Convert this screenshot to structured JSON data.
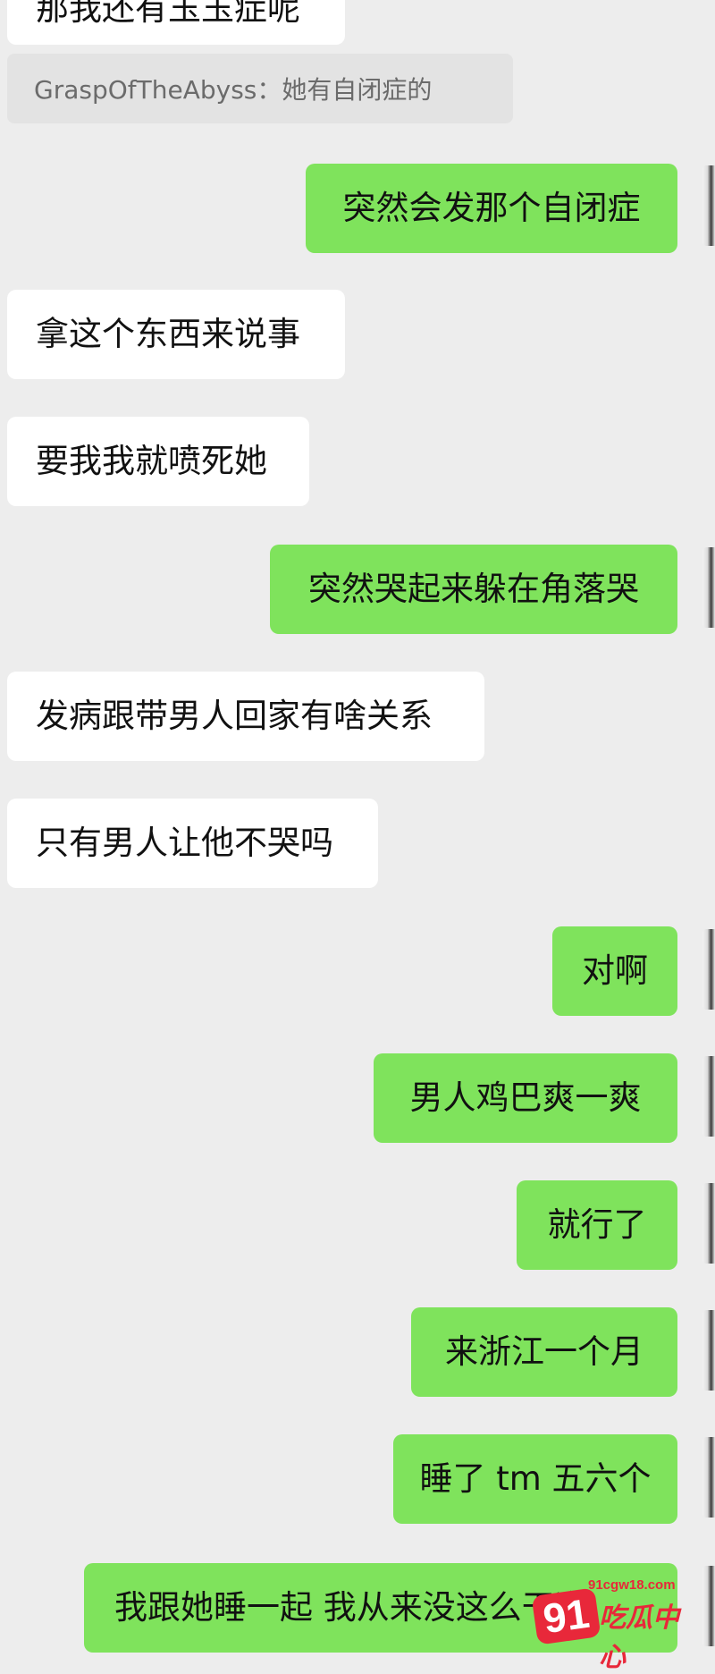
{
  "messages": [
    {
      "side": "in",
      "text": "那我还有玉玉症呢"
    },
    {
      "side": "quote",
      "text": "GraspOfTheAbyss：她有自闭症的"
    },
    {
      "side": "out",
      "text": "突然会发那个自闭症"
    },
    {
      "side": "in",
      "text": "拿这个东西来说事"
    },
    {
      "side": "in",
      "text": "要我我就喷死她"
    },
    {
      "side": "out",
      "text": "突然哭起来躲在角落哭"
    },
    {
      "side": "in",
      "text": "发病跟带男人回家有啥关系"
    },
    {
      "side": "in",
      "text": "只有男人让他不哭吗"
    },
    {
      "side": "out",
      "text": "对啊"
    },
    {
      "side": "out",
      "text": "男人鸡巴爽一爽"
    },
    {
      "side": "out",
      "text": "就行了"
    },
    {
      "side": "out",
      "text": "来浙江一个月"
    },
    {
      "side": "out",
      "text": "睡了 tm 五六个"
    },
    {
      "side": "out",
      "text": "我跟她睡一起 我从来没这么干净"
    }
  ],
  "watermark": {
    "number": "91",
    "url": "91cgw18.com",
    "text": "吃瓜中心"
  },
  "colors": {
    "background": "#ededed",
    "incoming_bubble": "#ffffff",
    "outgoing_bubble": "#7fe35c",
    "quote_bubble": "#e3e3e3",
    "watermark": "#e8283a"
  }
}
